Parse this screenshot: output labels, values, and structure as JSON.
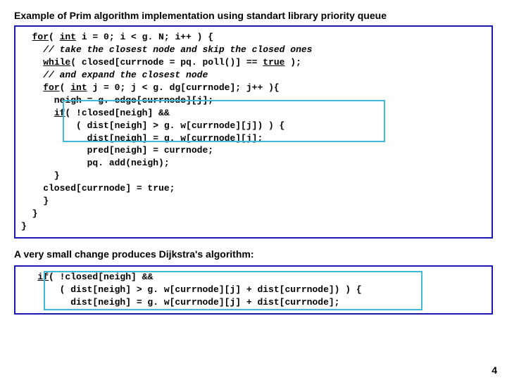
{
  "title": "Example of Prim algorithm implementation using standart library priority queue",
  "subtitle": "A very small change produces Dijkstra's algorithm:",
  "pagenum": "4",
  "code1": {
    "l0a": "for",
    "l0b": "( ",
    "l0c": "int",
    "l0d": " i = 0; i < g. N; i++ ) {",
    "l1": "    // take the closest node and skip the closed ones",
    "l2a": "while",
    "l2b": "( closed[currnode = pq. poll()] == ",
    "l2c": "true",
    "l2d": " );",
    "l3": "    // and expand the closest node",
    "l4a": "for",
    "l4b": "( ",
    "l4c": "int",
    "l4d": " j = 0; j < g. dg[currnode]; j++ ){",
    "l5": "      neigh = g. edge[currnode][j];",
    "l6a": "if",
    "l6b": "( !closed[neigh] &&",
    "l7": "          ( dist[neigh] > g. w[currnode][j]) ) {",
    "l8": "            dist[neigh] = g. w[currnode][j];",
    "l9": "            pred[neigh] = currnode;",
    "l10": "            pq. add(neigh);",
    "l11": "      }",
    "l12": "    closed[currnode] = true;",
    "l13": "    }",
    "l14": "  }",
    "l15": "}"
  },
  "code2": {
    "l0a": "if",
    "l0b": "( !closed[neigh] &&",
    "l1": "       ( dist[neigh] > g. w[currnode][j] + dist[currnode]) ) {",
    "l2": "         dist[neigh] = g. w[currnode][j] + dist[currnode];"
  }
}
